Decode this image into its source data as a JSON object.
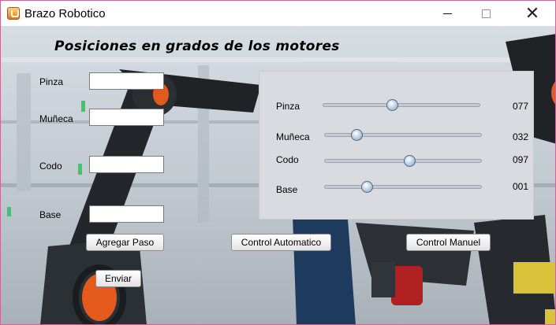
{
  "window": {
    "title": "Brazo Robotico",
    "minimize_glyph": "",
    "close_glyph": "✕"
  },
  "heading": "Posiciones en grados de los motores",
  "inputs": [
    {
      "label": "Pinza",
      "value": ""
    },
    {
      "label": "Muñeca",
      "value": ""
    },
    {
      "label": "Codo",
      "value": ""
    },
    {
      "label": "Base",
      "value": ""
    }
  ],
  "sliders": [
    {
      "label": "Pinza",
      "value_text": "077",
      "fraction": 0.44
    },
    {
      "label": "Muñeca",
      "value_text": "032",
      "fraction": 0.2
    },
    {
      "label": "Codo",
      "value_text": "097",
      "fraction": 0.54
    },
    {
      "label": "Base",
      "value_text": "001",
      "fraction": 0.27
    }
  ],
  "buttons": {
    "agregar_paso": "Agregar Paso",
    "control_automatico": "Control Automatico",
    "control_manuel": "Control Manuel",
    "enviar": "Enviar"
  },
  "colors": {
    "window_border": "#cc6699",
    "panel_bg": "#d9dbe0",
    "thumb": "#b8cde2"
  }
}
